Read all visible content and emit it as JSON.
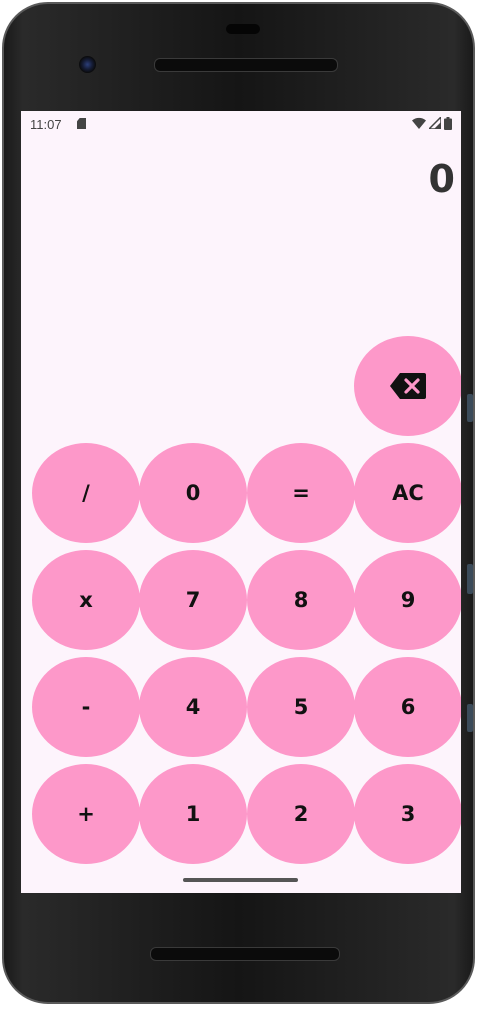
{
  "status_bar": {
    "time": "11:07",
    "icons": [
      "sd-card-icon",
      "wifi-icon",
      "signal-icon",
      "battery-icon"
    ]
  },
  "display": {
    "value": "0"
  },
  "keypad": {
    "backspace_icon": "backspace-icon",
    "rows": [
      [
        "/",
        "0",
        "=",
        "AC"
      ],
      [
        "x",
        "7",
        "8",
        "9"
      ],
      [
        "-",
        "4",
        "5",
        "6"
      ],
      [
        "+",
        "1",
        "2",
        "3"
      ]
    ]
  },
  "colors": {
    "key_background": "#fd98c9",
    "screen_background": "#fdf4fc",
    "key_text": "#111111"
  }
}
